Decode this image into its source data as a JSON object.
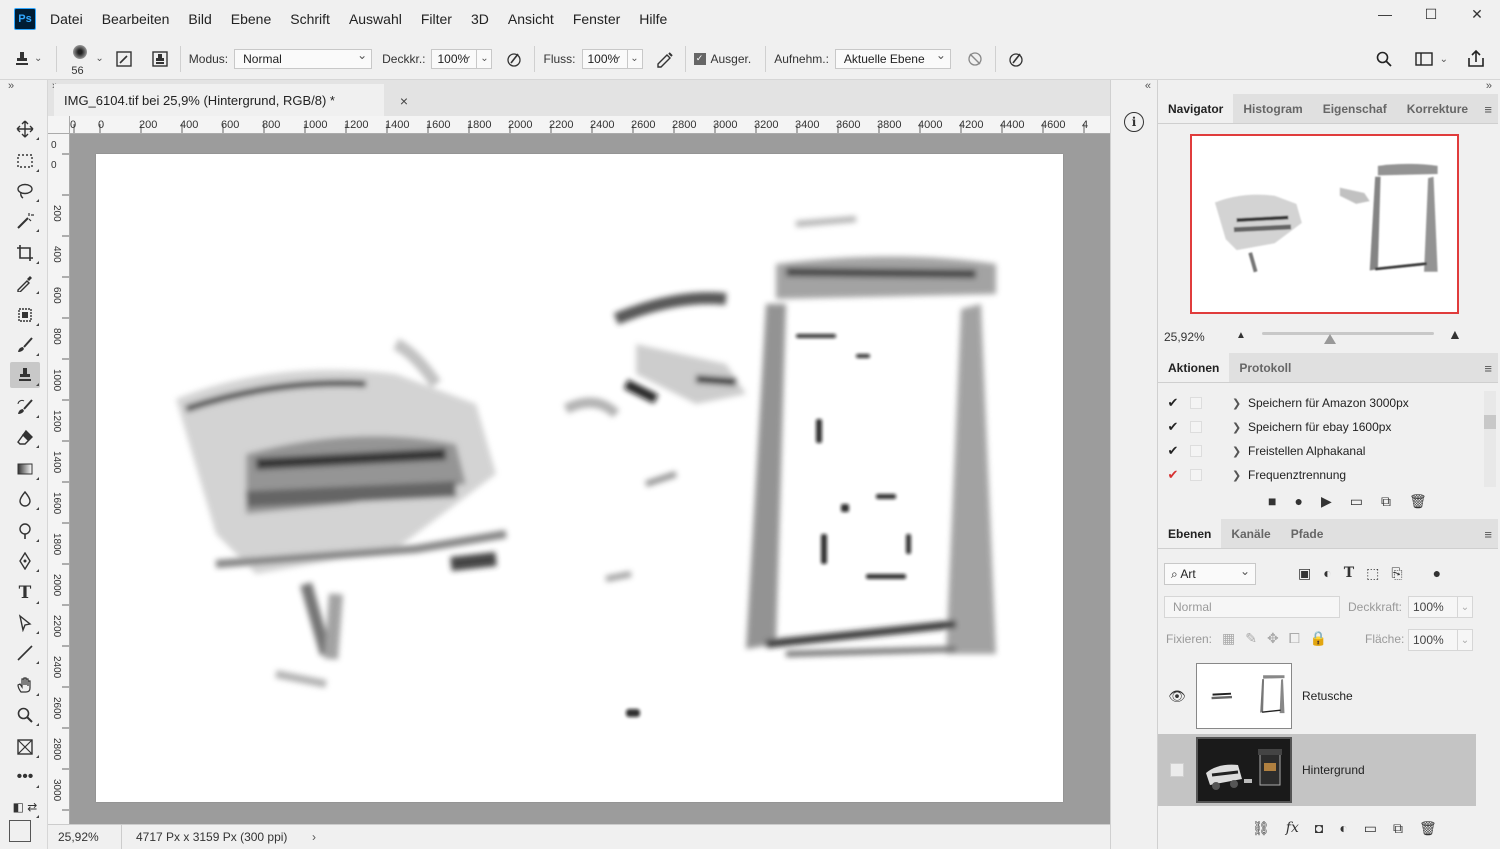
{
  "app": {
    "logo": "Ps"
  },
  "menu": [
    "Datei",
    "Bearbeiten",
    "Bild",
    "Ebene",
    "Schrift",
    "Auswahl",
    "Filter",
    "3D",
    "Ansicht",
    "Fenster",
    "Hilfe"
  ],
  "window_controls": {
    "minimize": "—",
    "restore": "☐",
    "close": "✕"
  },
  "options": {
    "brush_size": "56",
    "modus_label": "Modus:",
    "modus_value": "Normal",
    "deckkr_label": "Deckkr.:",
    "deckkr_value": "100%",
    "fluss_label": "Fluss:",
    "fluss_value": "100%",
    "ausger_label": "Ausger.",
    "aufnehm_label": "Aufnehm.:",
    "aufnehm_value": "Aktuelle Ebene"
  },
  "document": {
    "tab_title": "IMG_6104.tif bei 25,9% (Hintergrund, RGB/8) *",
    "close": "×",
    "ruler_h": [
      "0",
      "0",
      "200",
      "400",
      "600",
      "800",
      "1000",
      "1200",
      "1400",
      "1600",
      "1800",
      "2000",
      "2200",
      "2400",
      "2600",
      "2800",
      "3000",
      "3200",
      "3400",
      "3600",
      "3800",
      "4000",
      "4200",
      "4400",
      "4600",
      "4"
    ],
    "ruler_v": [
      "0",
      "0",
      "200",
      "400",
      "600",
      "800",
      "1000",
      "1200",
      "1400",
      "1600",
      "1800",
      "2000",
      "2200",
      "2400",
      "2600",
      "2800",
      "3000"
    ]
  },
  "status": {
    "zoom": "25,92%",
    "info": "4717 Px x 3159 Px (300 ppi)",
    "arrow": "›"
  },
  "navigator": {
    "tabs": [
      "Navigator",
      "Histogram",
      "Eigenschaf",
      "Korrekture"
    ],
    "zoom": "25,92%"
  },
  "actions": {
    "tabs": [
      "Aktionen",
      "Protokoll"
    ],
    "items": [
      {
        "label": "Speichern für Amazon 3000px",
        "check": "✔"
      },
      {
        "label": "Speichern für ebay 1600px",
        "check": "✔"
      },
      {
        "label": "Freistellen Alphakanal",
        "check": "✔"
      },
      {
        "label": "Frequenztrennung",
        "check": "✔"
      }
    ]
  },
  "layers": {
    "tabs": [
      "Ebenen",
      "Kanäle",
      "Pfade"
    ],
    "filter": "Art",
    "blend": "Normal",
    "deckkraft_label": "Deckkraft:",
    "deckkraft_value": "100%",
    "fixieren_label": "Fixieren:",
    "flaeche_label": "Fläche:",
    "flaeche_value": "100%",
    "items": [
      {
        "name": "Retusche",
        "visible": true
      },
      {
        "name": "Hintergrund",
        "visible": false
      }
    ]
  },
  "colors": {
    "accent_border": "#e03c3c",
    "canvas_bg": "#9c9c9c"
  }
}
